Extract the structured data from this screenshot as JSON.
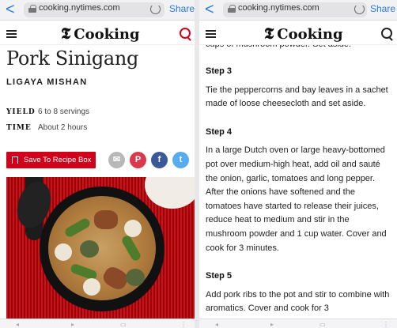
{
  "browser": {
    "url": "cooking.nytimes.com",
    "share_label": "Share",
    "back_glyph": "<"
  },
  "site": {
    "brand_mark": "𝕿",
    "brand_name": "Cooking"
  },
  "recipe": {
    "title": "Pork Sinigang",
    "author": "LIGAYA MISHAN",
    "yield_label": "YIELD",
    "yield_value": "6 to 8 servings",
    "time_label": "TIME",
    "time_value": "About 2 hours",
    "save_label": "Save To Recipe Box",
    "social": [
      {
        "icon": "email-icon",
        "glyph": "✉",
        "color": "#b8b8b8"
      },
      {
        "icon": "pinterest-icon",
        "glyph": "P",
        "color": "#d9394a"
      },
      {
        "icon": "facebook-icon",
        "glyph": "f",
        "color": "#3b5998"
      },
      {
        "icon": "twitter-icon",
        "glyph": "t",
        "color": "#55acee"
      }
    ]
  },
  "instructions": {
    "partial_top": "cups of mushroom powder. Set aside.",
    "steps": [
      {
        "heading": "Step 3",
        "text": "Tie the peppercorns and bay leaves in a sachet made of loose cheesecloth and set aside."
      },
      {
        "heading": "Step 4",
        "text": "In a large Dutch oven or large heavy-bottomed pot over medium-high heat, add oil and sauté the onion, garlic, tomatoes and long pepper. After the onions have softened and the tomatoes have started to release their juices, reduce heat to medium and stir in the mushroom powder and 1 cup water. Cover and cook for 3 minutes."
      },
      {
        "heading": "Step 5",
        "text": "Add pork ribs to the pot and stir to combine with aromatics. Cover and cook for 3"
      }
    ]
  },
  "colors": {
    "accent": "#d0021b",
    "link": "#2a7ae2"
  }
}
